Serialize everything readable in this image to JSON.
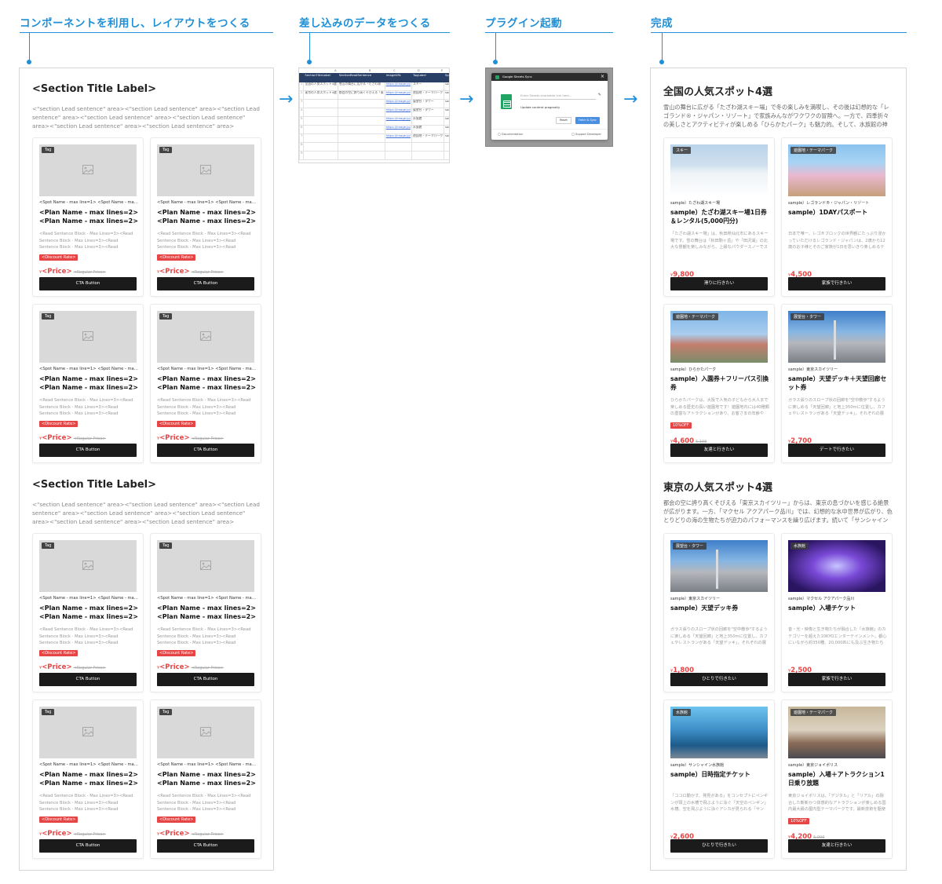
{
  "steps": [
    {
      "title": "コンポーネントを利用し、レイアウトをつくる"
    },
    {
      "title": "差し込みのデータをつくる"
    },
    {
      "title": "プラグイン起動"
    },
    {
      "title": "完成"
    }
  ],
  "template": {
    "sections": [
      {
        "title": "<Section Title Label>",
        "lead": "<\"section Lead sentence\" area><\"section Lead sentence\" area><\"section Lead sentence\" area><\"section Lead sentence\" area><\"section Lead sentence\" area><\"section Lead sentence\" area><\"section Lead sentence\" area><\"section Lead sentence\" area><\"section Lead sentence\" area><\"sectio…"
      },
      {
        "title": "<Section Title Label>",
        "lead": "<\"section Lead sentence\" area><\"section Lead sentence\" area><\"section Lead sentence\" area><\"section Lead sentence\" area><\"section Lead sentence\" area><\"section Lead sentence\" area><\"section Lead sentence\" area><\"section Lead sentence\" area><\"section Lead sentence\" area><\"sectio…"
      }
    ],
    "card": {
      "tag": "Tag",
      "spot": "<Spot Name - max line=1> <Spot Name - max line=1> <Spot Name - max line=1>",
      "plan": "<Plan Name - max lines=2> <Plan Name - max lines=2> <Plan Name - max lines=2>...",
      "read": "<Read Sentence Block - Max Lines=3><Read Sentence Block - Max Lines=3><Read Sentence Block - Max Lines=3><Read Sentence Block - Max Lines=3><Read Sentence Block - Max Lines=3>",
      "discount": "<Discount Rate>",
      "yen": "¥",
      "price": "<Price>",
      "regular": "<Regular Price>",
      "cta": "CTA Button"
    }
  },
  "sheet": {
    "col_letters": [
      "A",
      "B",
      "C",
      "D",
      "E"
    ],
    "header": [
      "",
      "SectionTitleLabel",
      "SectionReadSentence",
      "ImageURL",
      "TagLabel",
      "SpotName"
    ],
    "rows": [
      [
        "1",
        "全国の人気スポット4選",
        "雪山の舞台に広がる「たざわ湖",
        "https://image.jp/",
        "スキー",
        "sample)たざわ湖"
      ],
      [
        "2",
        "東京の人気スポット4選",
        "都会の空に誇り高くそびえる「東",
        "https://image.jp/",
        "遊園地・テーマパーク",
        "sample)レゴランド"
      ],
      [
        "3",
        "",
        "",
        "https://image.jp/",
        "展望台・タワー",
        "sample)ひらかた"
      ],
      [
        "4",
        "",
        "",
        "https://image.jp/",
        "展望台・タワー",
        "sample)東京スカイ"
      ],
      [
        "5",
        "",
        "",
        "https://image.jp/",
        "水族館",
        "sample)マクセル"
      ],
      [
        "6",
        "",
        "",
        "https://image.jp/",
        "水族館",
        "sample)サンシャイン"
      ],
      [
        "7",
        "",
        "",
        "https://image.jp/",
        "遊園地・テーマパーク",
        "sample)東京ジョイ"
      ],
      [
        "8",
        "",
        "",
        "",
        "",
        ""
      ],
      [
        "9",
        "",
        "",
        "",
        "",
        ""
      ]
    ]
  },
  "plugin": {
    "window_title": "Google Sheets Sync",
    "input_placeholder": "Enter Sheets shareable link here...",
    "message": "Update content pragmatly",
    "cancel": "Reset",
    "fetch": "Fetch & Sync",
    "documentation": "Documentation",
    "support": "Support Developer"
  },
  "result": {
    "sections": [
      {
        "title": "全国の人気スポット4選",
        "lead": "雪山の舞台に広がる「たざわ湖スキー場」で冬の楽しみを満喫し、その後は幻想的な「レゴランド®・ジャパン・リゾート」で家族みんながワクワクの冒険へ。一方で、四季折々の美しさとアクティビティが楽しめる「ひらかたパーク」も魅力的。そして、水族館の神秘的…",
        "cards": [
          {
            "tag": "スキー",
            "spot": "sample）たざわ湖スキー場",
            "plan": "sample）たざわ湖スキー場1日券＆レンタル(5,000円分)",
            "read": "「たざわ湖スキー場」は、秋田県仙北市にあるスキー場です。雪の舞台は「秋田駒ヶ岳」や「田沢湖」の北大な景観を楽しみながら、上級なパウダースノーでスキー…",
            "discount": "",
            "price": "9,800",
            "regular": "",
            "cta": "滑りに行きたい",
            "photo": "ski"
          },
          {
            "tag": "遊園地・テーマパーク",
            "spot": "sample）レゴランド®・ジャパン・リゾート",
            "plan": "sample）1DAYパスポート",
            "read": "日本で唯一、レゴ®ブロックの世界観にたっぷり浸かっていただけるレゴランド・ジャパンは、2歳から12歳のお子様とそのご家族が1日を思いきり楽しめるテーマ…",
            "discount": "",
            "price": "4,500",
            "regular": "",
            "cta": "家族で行きたい",
            "photo": "lego"
          },
          {
            "tag": "遊園地・テーマパーク",
            "spot": "sample）ひらかたパーク",
            "plan": "sample）入園券＋フリーパス引換券",
            "read": "ひらかたパークは、大阪で人気の子どもから大人まで楽しめる歴史の長い遊園地です！遊園地内には40種類の豊富なアトラクションがあり、お客さまの年齢や好…",
            "discount": "10%OFF",
            "price": "4,600",
            "regular": "5,100",
            "cta": "友達と行きたい",
            "photo": "park"
          },
          {
            "tag": "展望台・タワー",
            "spot": "sample）東京スカイツリー",
            "plan": "sample）天望デッキ＋天望回廊セット券",
            "read": "ガラス張りのスロープ状の回廊を\"空中散歩\"するように楽しめる「天望回廊」と地上350mに位置し、カフェやレストランがある「天望デッキ」。それぞれの展望台…",
            "discount": "",
            "price": "2,700",
            "regular": "",
            "cta": "デートで行きたい",
            "photo": "tower"
          }
        ]
      },
      {
        "title": "東京の人気スポット4選",
        "lead": "都会の空に誇り高くそびえる「東京スカイツリー」からは、東京の息づかいを感じる絶景が広がります。一方、「マクセル アクアパーク品川」では、幻想的な水中世界が広がり、色とりどりの海の生物たちが迫力のパフォーマンスを繰り広げます。続いて「サンシャイン水…",
        "cards": [
          {
            "tag": "展望台・タワー",
            "spot": "sample）東京スカイツリー",
            "plan": "sample）天望デッキ券",
            "read": "ガラス張りのスロープ状の回廊を\"空中散歩\"するように楽しめる「天望回廊」と地上350mに位置し、カフェやレストランがある「天望デッキ」。それぞれの展望台…",
            "discount": "",
            "price": "1,800",
            "regular": "",
            "cta": "ひとりで行きたい",
            "photo": "tower"
          },
          {
            "tag": "水族館",
            "spot": "sample）マクセル アクアパーク品川",
            "plan": "sample）入場チケット",
            "read": "音・光・映像と生き物たちが融合した「水族館」のカテゴリーを超えた10KYOエンターテインメント。都心にいながら約350種、20,000匹にも及ぶ生き物たちに出会…",
            "discount": "",
            "price": "2,500",
            "regular": "",
            "cta": "家族で行きたい",
            "photo": "aqua"
          },
          {
            "tag": "水族館",
            "spot": "sample）サンシャイン水族館",
            "plan": "sample）日時指定チケット",
            "read": "「ココロ動かす、発見がある」をコンセプトにペンギンが頭上の水槽で飛ぶように泳ぐ「天空のペンギン」水槽。空を飛ぶように泳ぐアシカが見られる「サンシ…",
            "discount": "",
            "price": "2,600",
            "regular": "",
            "cta": "ひとりで行きたい",
            "photo": "penguin"
          },
          {
            "tag": "遊園地・テーマパーク",
            "spot": "sample）東京ジョイポリス",
            "plan": "sample）入場＋アトラクション1日乗り放題",
            "read": "東京ジョイポリスは、「デジタル」と「リアル」の融合した斬新かつ体感的なアトラクションが楽しめる国内最大級の屋内型テーマパークです。最新技術を駆使した…",
            "discount": "10%OFF",
            "price": "4,200",
            "regular": "5,000",
            "cta": "友達と行きたい",
            "photo": "city"
          }
        ]
      }
    ],
    "yen": "¥"
  },
  "colors": {
    "accent": "#1f8fd6",
    "cta": "#1b1b1b",
    "discount": "#e64545"
  }
}
